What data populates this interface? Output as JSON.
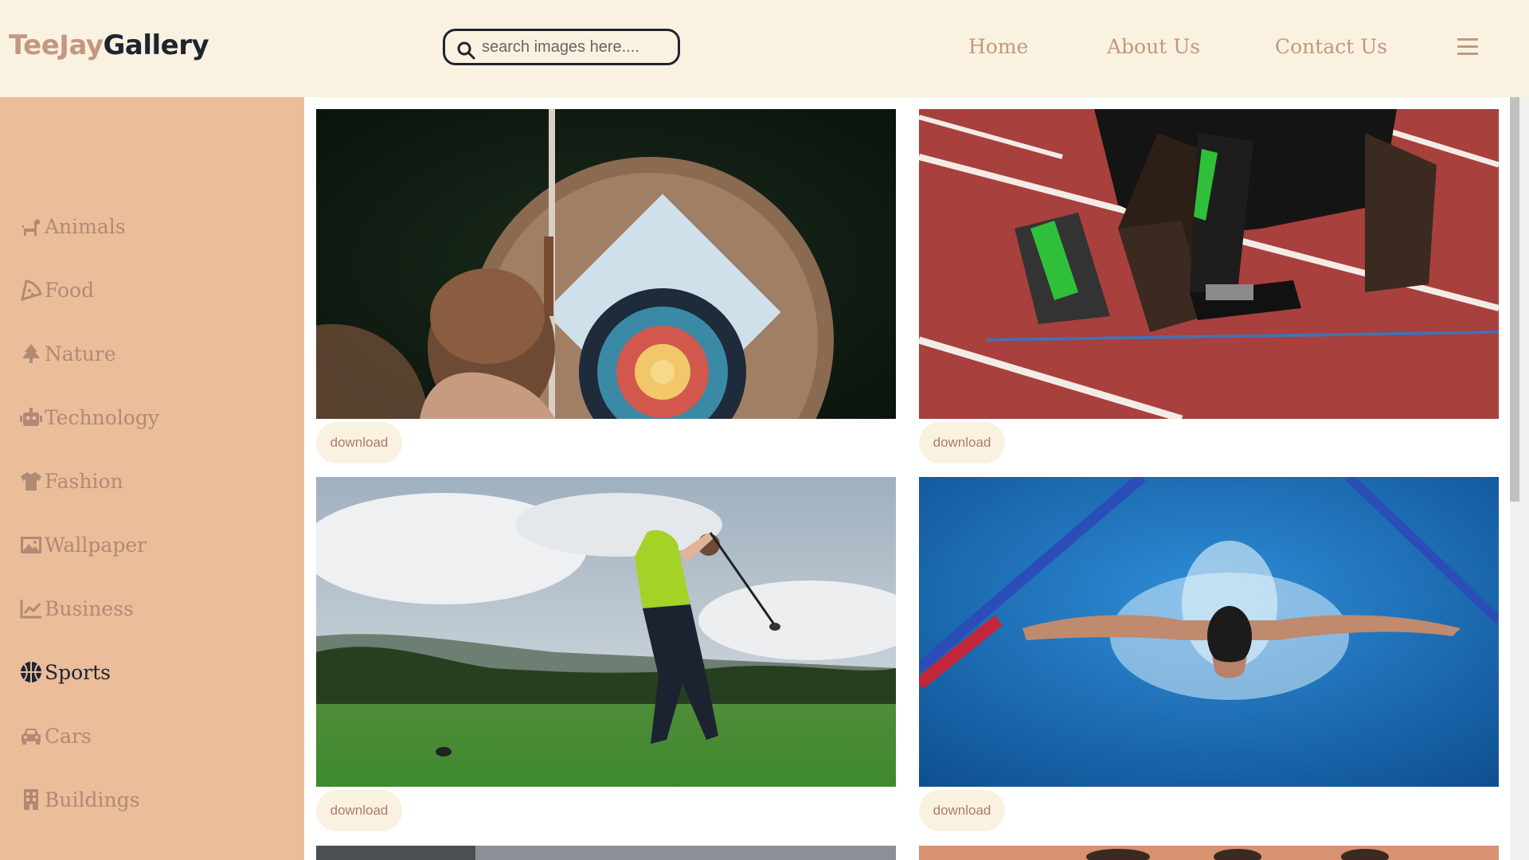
{
  "app": {
    "logo_part1": "TeeJay",
    "logo_part2": "Gallery"
  },
  "search": {
    "placeholder": "search images here....",
    "value": ""
  },
  "nav": {
    "home": "Home",
    "about": "About Us",
    "contact": "Contact Us"
  },
  "sidebar": {
    "items": [
      {
        "label": "Animals",
        "icon": "dog-icon"
      },
      {
        "label": "Food",
        "icon": "pizza-icon"
      },
      {
        "label": "Nature",
        "icon": "tree-icon"
      },
      {
        "label": "Technology",
        "icon": "robot-icon"
      },
      {
        "label": "Fashion",
        "icon": "shirt-icon"
      },
      {
        "label": "Wallpaper",
        "icon": "image-icon"
      },
      {
        "label": "Business",
        "icon": "chart-line-icon"
      },
      {
        "label": "Sports",
        "icon": "basketball-icon",
        "active": true
      },
      {
        "label": "Cars",
        "icon": "car-icon"
      },
      {
        "label": "Buildings",
        "icon": "building-icon"
      }
    ]
  },
  "gallery": {
    "download_label": "download",
    "images": [
      {
        "subject": "archery"
      },
      {
        "subject": "sprint start"
      },
      {
        "subject": "golf swing"
      },
      {
        "subject": "butterfly swimming"
      }
    ]
  },
  "colors": {
    "header_bg": "#faf2e0",
    "sidebar_bg": "#ebbd9b",
    "accent": "#c49780",
    "dark": "#1f2430"
  }
}
